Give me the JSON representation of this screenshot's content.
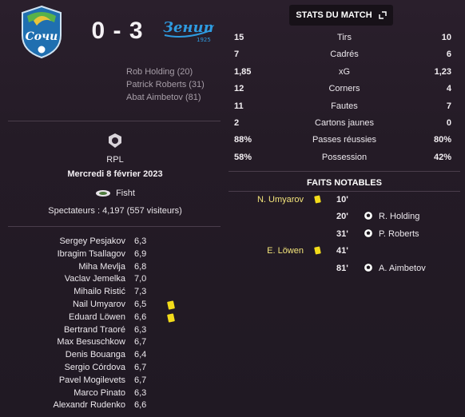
{
  "match": {
    "home_team_logo_text": "Сочи",
    "away_team_logo_text": "Зенит",
    "away_team_logo_year": "1925",
    "score": "0 - 3",
    "away_scorers": [
      "Rob Holding (20)",
      "Patrick Roberts (31)",
      "Abat Aimbetov (81)"
    ]
  },
  "info": {
    "competition": "RPL",
    "date": "Mercredi 8 février 2023",
    "stadium": "Fisht",
    "attendance": "Spectateurs : 4,197 (557 visiteurs)"
  },
  "players": [
    {
      "name": "Sergey Pesjakov",
      "rating": "6,3",
      "card": false
    },
    {
      "name": "Ibragim Tsallagov",
      "rating": "6,9",
      "card": false
    },
    {
      "name": "Miha Mevlja",
      "rating": "6,8",
      "card": false
    },
    {
      "name": "Vaclav Jemelka",
      "rating": "7,0",
      "card": false
    },
    {
      "name": "Mihailo Ristić",
      "rating": "7,3",
      "card": false
    },
    {
      "name": "Nail Umyarov",
      "rating": "6,5",
      "card": true
    },
    {
      "name": "Eduard Löwen",
      "rating": "6,6",
      "card": true
    },
    {
      "name": "Bertrand Traoré",
      "rating": "6,3",
      "card": false
    },
    {
      "name": "Max Besuschkow",
      "rating": "6,7",
      "card": false
    },
    {
      "name": "Denis Bouanga",
      "rating": "6,4",
      "card": false
    },
    {
      "name": "Sergio Córdova",
      "rating": "6,7",
      "card": false
    },
    {
      "name": "Pavel Mogilevets",
      "rating": "6,7",
      "card": false
    },
    {
      "name": "Marco Pinato",
      "rating": "6,3",
      "card": false
    },
    {
      "name": "Alexandr Rudenko",
      "rating": "6,6",
      "card": false
    }
  ],
  "stats_panel": {
    "title": "STATS DU MATCH",
    "icon": "expand-icon",
    "rows": [
      {
        "label": "Tirs",
        "home": "15",
        "away": "10"
      },
      {
        "label": "Cadrés",
        "home": "7",
        "away": "6"
      },
      {
        "label": "xG",
        "home": "1,85",
        "away": "1,23"
      },
      {
        "label": "Corners",
        "home": "12",
        "away": "4"
      },
      {
        "label": "Fautes",
        "home": "11",
        "away": "7"
      },
      {
        "label": "Cartons jaunes",
        "home": "2",
        "away": "0"
      },
      {
        "label": "Passes réussies",
        "home": "88%",
        "away": "80%"
      },
      {
        "label": "Possession",
        "home": "58%",
        "away": "42%"
      }
    ]
  },
  "events_panel": {
    "title": "FAITS NOTABLES",
    "events": [
      {
        "minute": "10'",
        "home_player": "N. Umyarov",
        "home_icon": "yellow-card-icon",
        "away_player": "",
        "away_icon": ""
      },
      {
        "minute": "20'",
        "home_player": "",
        "home_icon": "",
        "away_player": "R. Holding",
        "away_icon": "goal-ball-icon"
      },
      {
        "minute": "31'",
        "home_player": "",
        "home_icon": "",
        "away_player": "P. Roberts",
        "away_icon": "goal-ball-icon"
      },
      {
        "minute": "41'",
        "home_player": "E. Löwen",
        "home_icon": "yellow-card-icon",
        "away_player": "",
        "away_icon": ""
      },
      {
        "minute": "81'",
        "home_player": "",
        "home_icon": "",
        "away_player": "A. Aimbetov",
        "away_icon": "goal-ball-icon"
      }
    ]
  },
  "colors": {
    "background": "#241b26",
    "yellow_card": "#f3dc1a",
    "event_highlight": "#f2e37a",
    "sochi_blue": "#2a7fc0",
    "zenit_blue": "#2e9be0"
  }
}
